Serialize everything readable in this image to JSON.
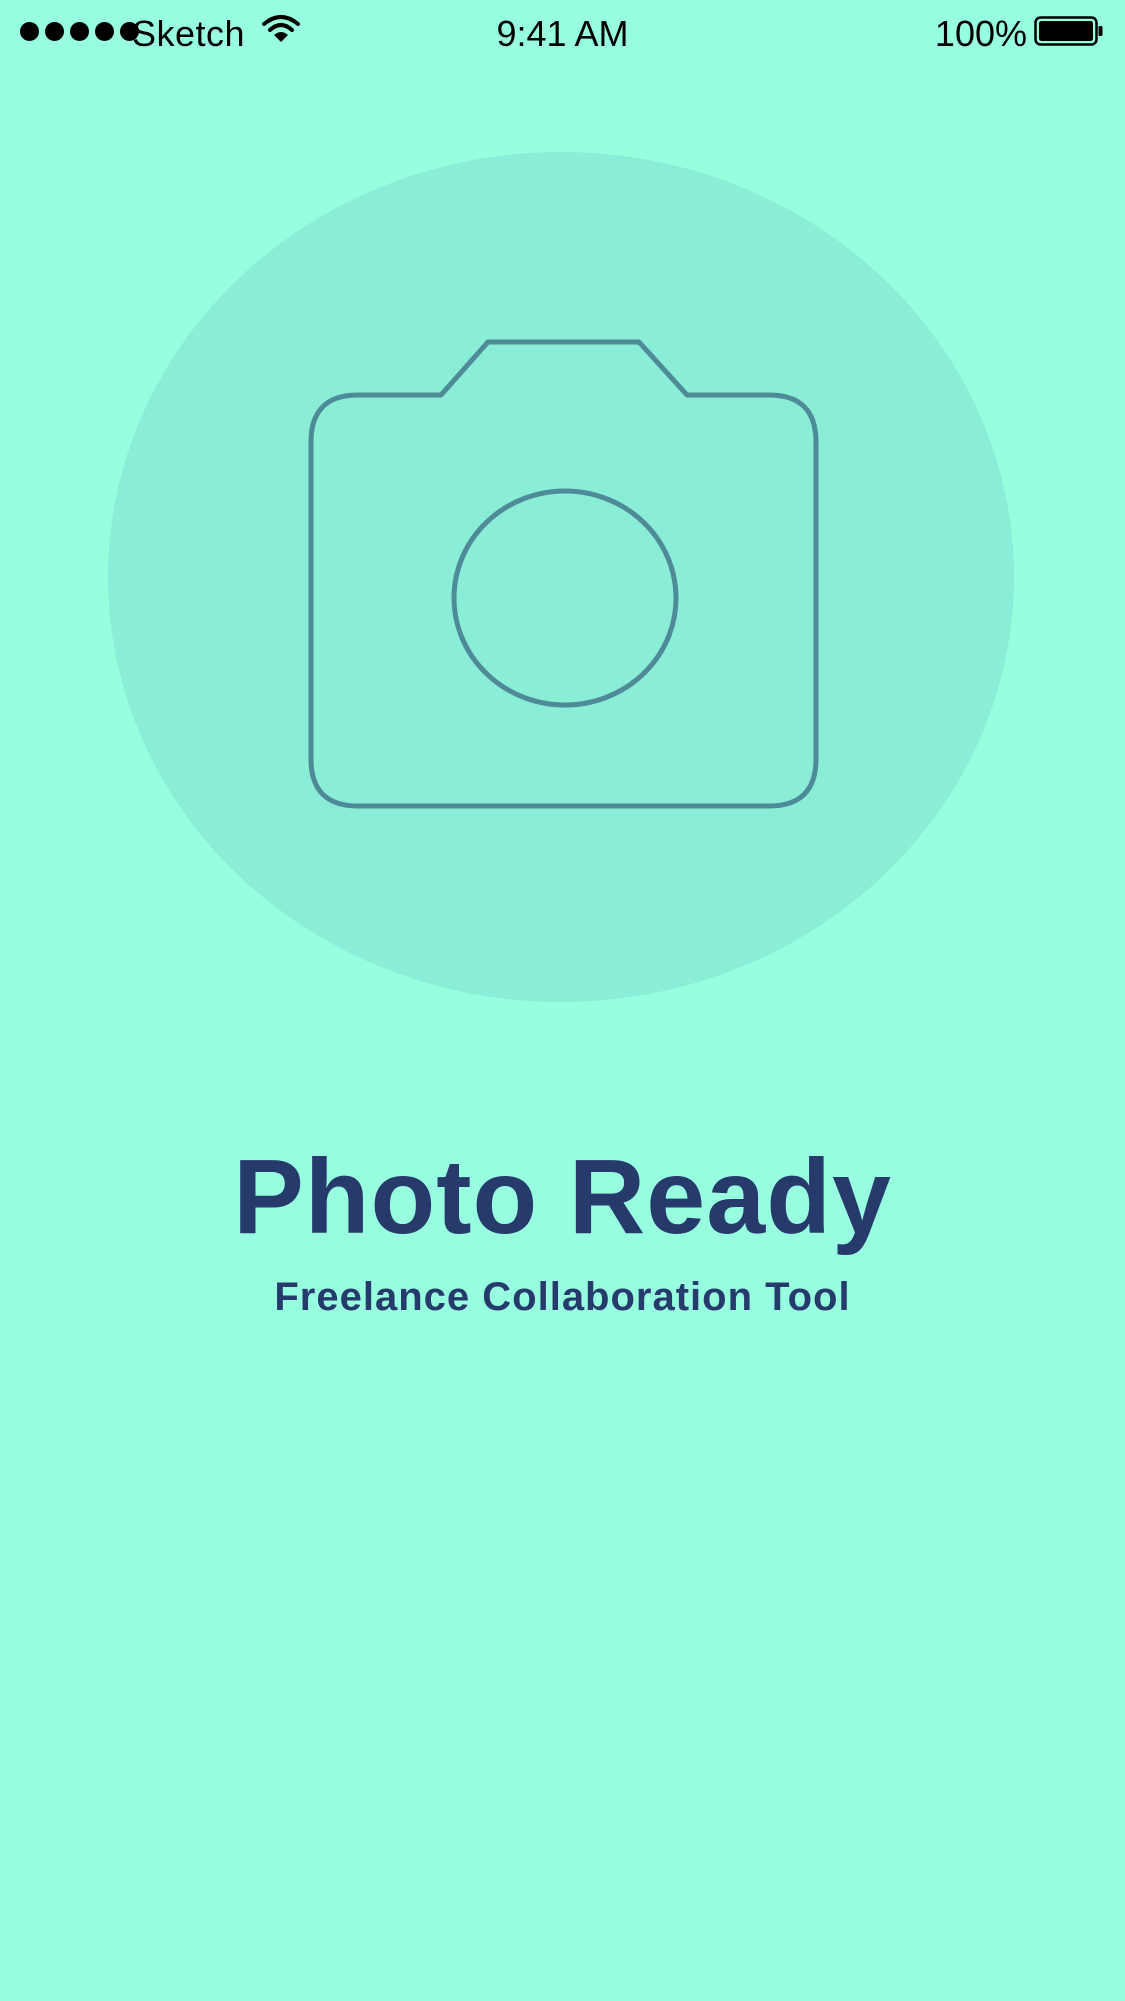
{
  "status_bar": {
    "carrier": "Sketch",
    "time": "9:41 AM",
    "battery_percent": "100%",
    "signal_icon": "signal-dots-icon",
    "wifi_icon": "wifi-icon",
    "battery_icon": "battery-icon"
  },
  "hero": {
    "icon": "camera-icon"
  },
  "title": "Photo Ready",
  "subtitle": "Freelance Collaboration Tool",
  "colors": {
    "background": "#97FFDF",
    "hero_circle": "#8AEDD5",
    "camera_stroke": "#4E8A97",
    "text_primary": "#263A6C",
    "status_text": "#000000"
  }
}
